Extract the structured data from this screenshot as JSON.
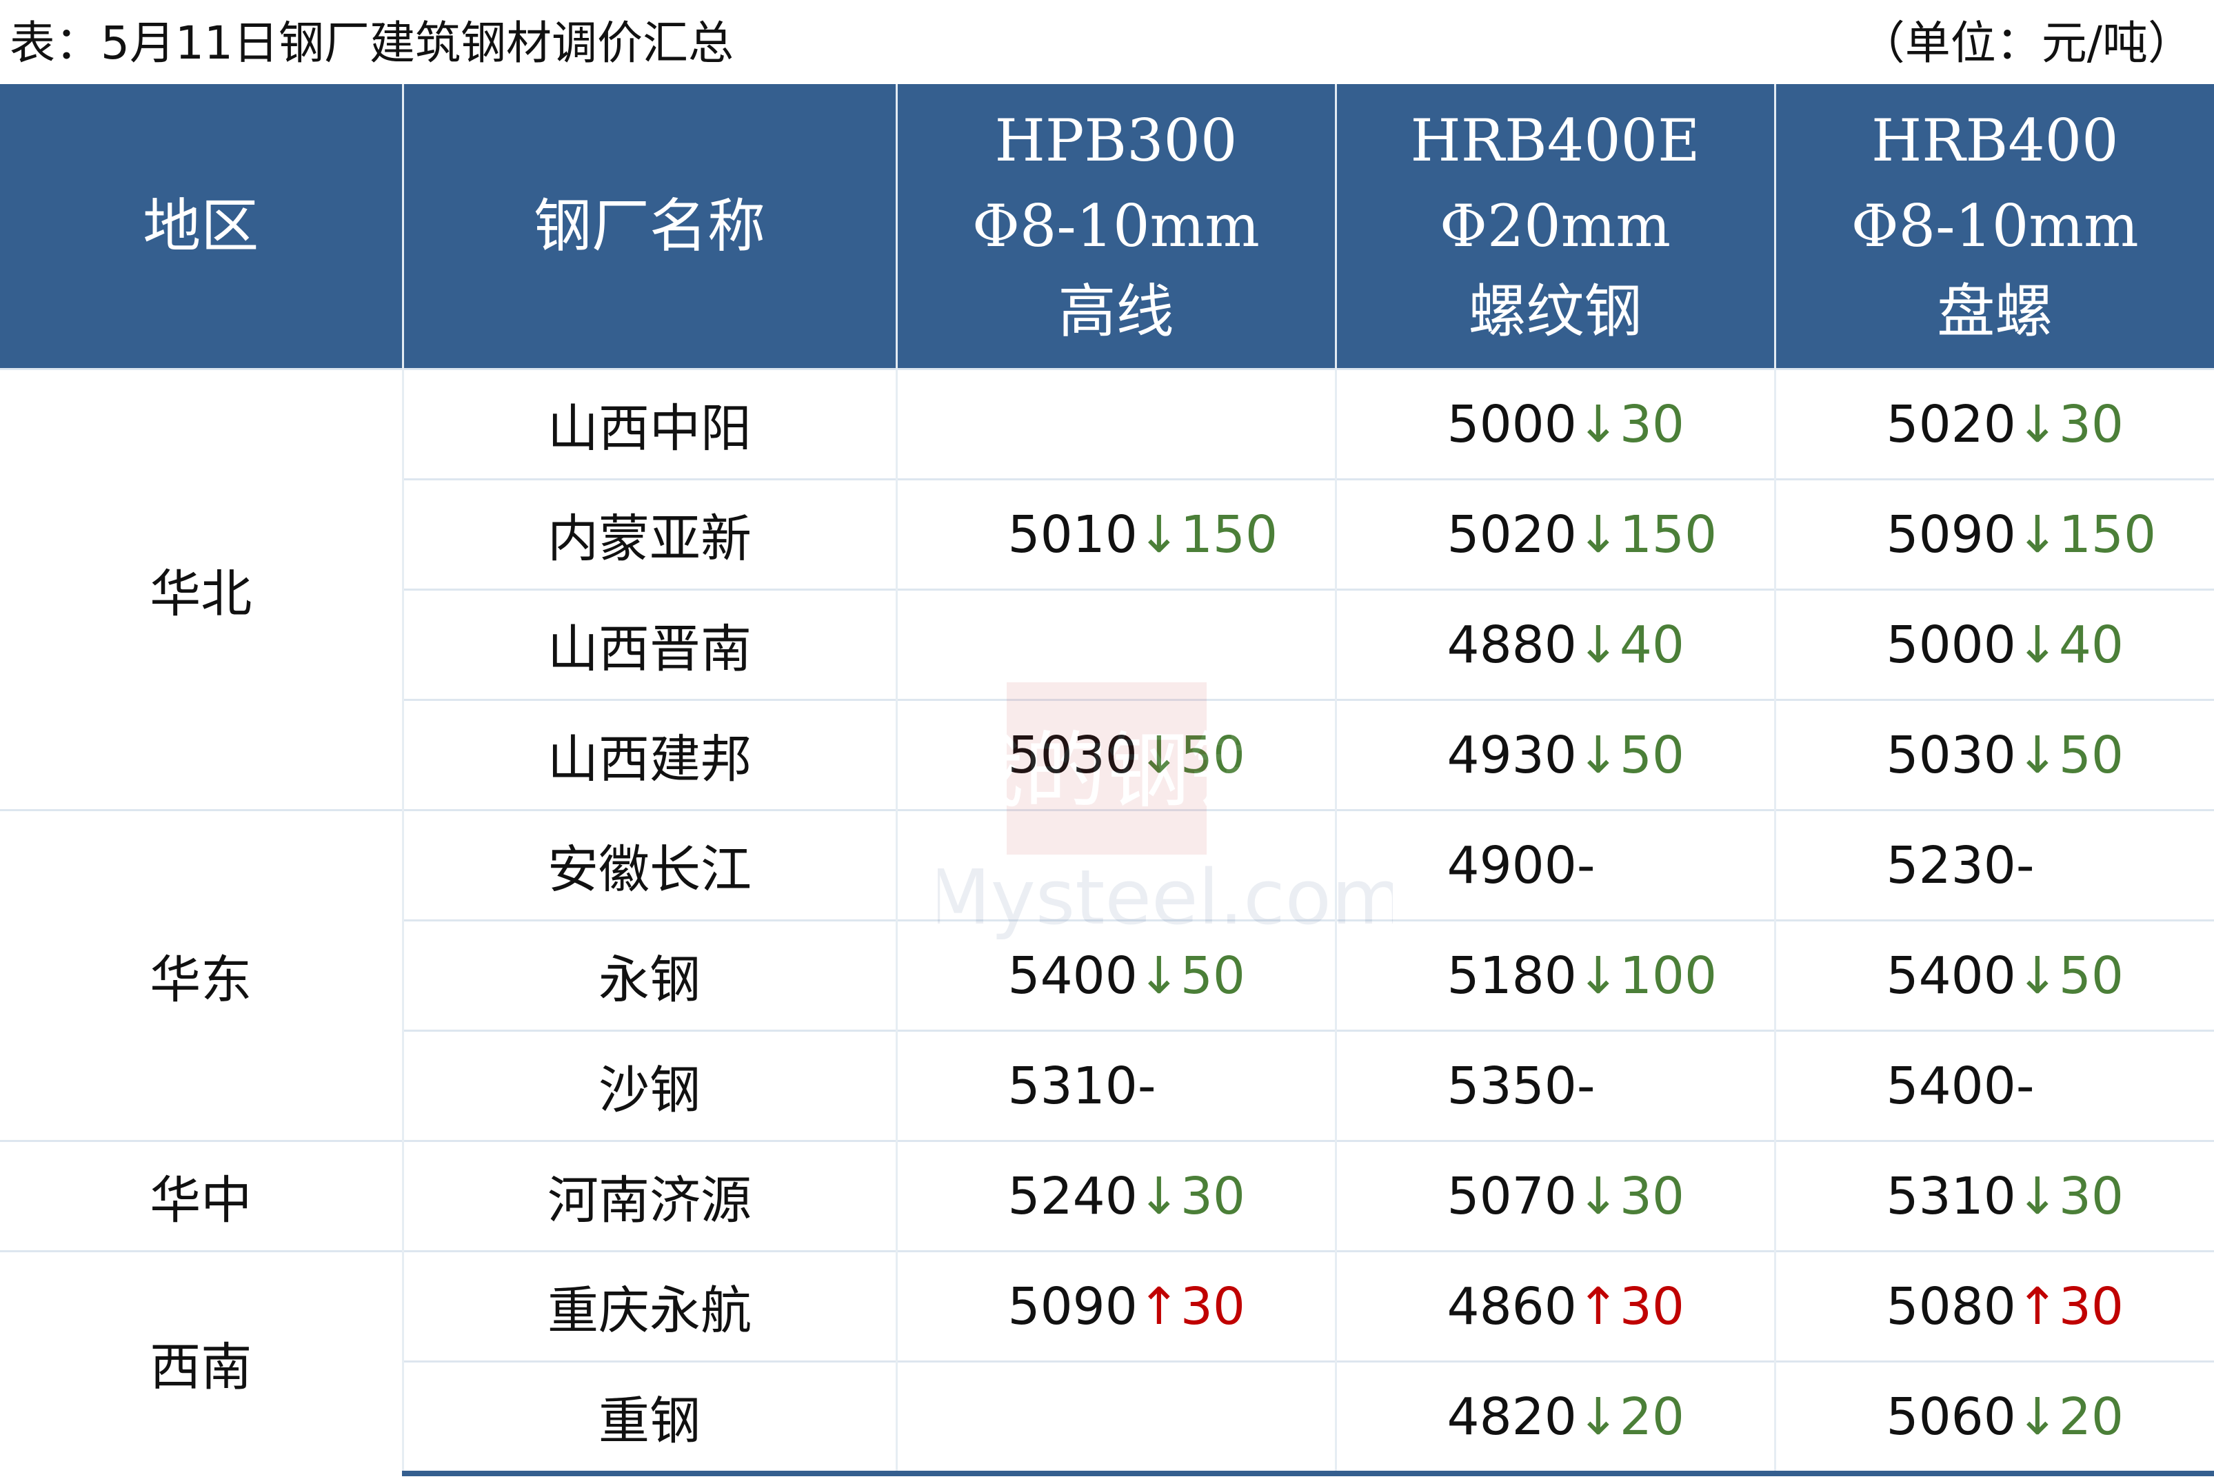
{
  "title": "表：5月11日钢厂建筑钢材调价汇总",
  "unit": "（单位：元/吨）",
  "headers": {
    "region": "地区",
    "mill": "钢厂名称",
    "col1": [
      "HPB300",
      "Φ8-10mm",
      "高线"
    ],
    "col2": [
      "HRB400E",
      "Φ20mm",
      "螺纹钢"
    ],
    "col3": [
      "HRB400",
      "Φ8-10mm",
      "盘螺"
    ]
  },
  "regions": [
    "华北",
    "华东",
    "华中",
    "西南"
  ],
  "rows": [
    {
      "mill": "山西中阳",
      "c1": {
        "price": "",
        "arrow": "",
        "chg": "",
        "dir": ""
      },
      "c2": {
        "price": "5000",
        "arrow": "↓",
        "chg": "30",
        "dir": "down"
      },
      "c3": {
        "price": "5020",
        "arrow": "↓",
        "chg": "30",
        "dir": "down"
      }
    },
    {
      "mill": "内蒙亚新",
      "c1": {
        "price": "5010",
        "arrow": "↓",
        "chg": "150",
        "dir": "down"
      },
      "c2": {
        "price": "5020",
        "arrow": "↓",
        "chg": "150",
        "dir": "down"
      },
      "c3": {
        "price": "5090",
        "arrow": "↓",
        "chg": "150",
        "dir": "down"
      }
    },
    {
      "mill": "山西晋南",
      "c1": {
        "price": "",
        "arrow": "",
        "chg": "",
        "dir": ""
      },
      "c2": {
        "price": "4880",
        "arrow": "↓",
        "chg": "40",
        "dir": "down"
      },
      "c3": {
        "price": "5000",
        "arrow": "↓",
        "chg": "40",
        "dir": "down"
      }
    },
    {
      "mill": "山西建邦",
      "c1": {
        "price": "5030",
        "arrow": "↓",
        "chg": "50",
        "dir": "down"
      },
      "c2": {
        "price": "4930",
        "arrow": "↓",
        "chg": "50",
        "dir": "down"
      },
      "c3": {
        "price": "5030",
        "arrow": "↓",
        "chg": "50",
        "dir": "down"
      }
    },
    {
      "mill": "安徽长江",
      "c1": {
        "price": "",
        "arrow": "",
        "chg": "",
        "dir": ""
      },
      "c2": {
        "price": "4900",
        "arrow": "-",
        "chg": "",
        "dir": "flat"
      },
      "c3": {
        "price": "5230",
        "arrow": "-",
        "chg": "",
        "dir": "flat"
      }
    },
    {
      "mill": "永钢",
      "c1": {
        "price": "5400",
        "arrow": "↓",
        "chg": "50",
        "dir": "down"
      },
      "c2": {
        "price": "5180",
        "arrow": "↓",
        "chg": "100",
        "dir": "down"
      },
      "c3": {
        "price": "5400",
        "arrow": "↓",
        "chg": "50",
        "dir": "down"
      }
    },
    {
      "mill": "沙钢",
      "c1": {
        "price": "5310",
        "arrow": "-",
        "chg": "",
        "dir": "flat"
      },
      "c2": {
        "price": "5350",
        "arrow": "-",
        "chg": "",
        "dir": "flat"
      },
      "c3": {
        "price": "5400",
        "arrow": "-",
        "chg": "",
        "dir": "flat"
      }
    },
    {
      "mill": "河南济源",
      "c1": {
        "price": "5240",
        "arrow": "↓",
        "chg": "30",
        "dir": "down"
      },
      "c2": {
        "price": "5070",
        "arrow": "↓",
        "chg": "30",
        "dir": "down"
      },
      "c3": {
        "price": "5310",
        "arrow": "↓",
        "chg": "30",
        "dir": "down"
      }
    },
    {
      "mill": "重庆永航",
      "c1": {
        "price": "5090",
        "arrow": "↑",
        "chg": "30",
        "dir": "up"
      },
      "c2": {
        "price": "4860",
        "arrow": "↑",
        "chg": "30",
        "dir": "up"
      },
      "c3": {
        "price": "5080",
        "arrow": "↑",
        "chg": "30",
        "dir": "up"
      }
    },
    {
      "mill": "重钢",
      "c1": {
        "price": "",
        "arrow": "",
        "chg": "",
        "dir": ""
      },
      "c2": {
        "price": "4820",
        "arrow": "↓",
        "chg": "20",
        "dir": "down"
      },
      "c3": {
        "price": "5060",
        "arrow": "↓",
        "chg": "20",
        "dir": "down"
      }
    }
  ],
  "watermark": {
    "line1": "我的钢铁",
    "line2": "Mysteel.com"
  },
  "colors": {
    "header_bg": "#355f8f",
    "down": "#4b7f38",
    "up": "#c00000"
  }
}
